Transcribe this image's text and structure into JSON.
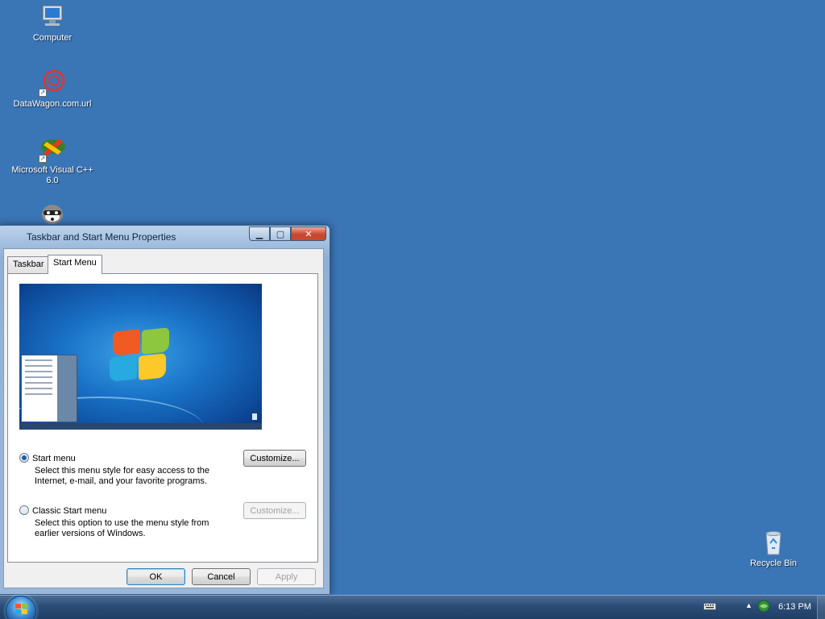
{
  "desktop": {
    "icons": [
      {
        "label": "Computer",
        "icon": "computer-icon"
      },
      {
        "label": "DataWagon.com.url",
        "icon": "web-shortcut-icon"
      },
      {
        "label": "Microsoft Visual C++ 6.0",
        "icon": "visual-cpp-icon"
      },
      {
        "label": "",
        "icon": "raccoon-icon"
      },
      {
        "label": "Recycle Bin",
        "icon": "recycle-bin-icon"
      }
    ]
  },
  "dialog": {
    "title": "Taskbar and Start Menu Properties",
    "tabs": [
      {
        "label": "Taskbar",
        "active": false
      },
      {
        "label": "Start Menu",
        "active": true
      }
    ],
    "options": {
      "start_menu": {
        "label": "Start menu",
        "checked": true,
        "description": "Select this menu style for easy access to the Internet, e-mail, and your favorite programs.",
        "customize": "Customize..."
      },
      "classic": {
        "label": "Classic Start menu",
        "checked": false,
        "description": "Select this option to use the menu style from earlier versions of Windows.",
        "customize": "Customize..."
      }
    },
    "buttons": {
      "ok": "OK",
      "cancel": "Cancel",
      "apply": "Apply"
    }
  },
  "taskbar": {
    "clock": "6:13 PM",
    "accent": "#3a75b6"
  }
}
